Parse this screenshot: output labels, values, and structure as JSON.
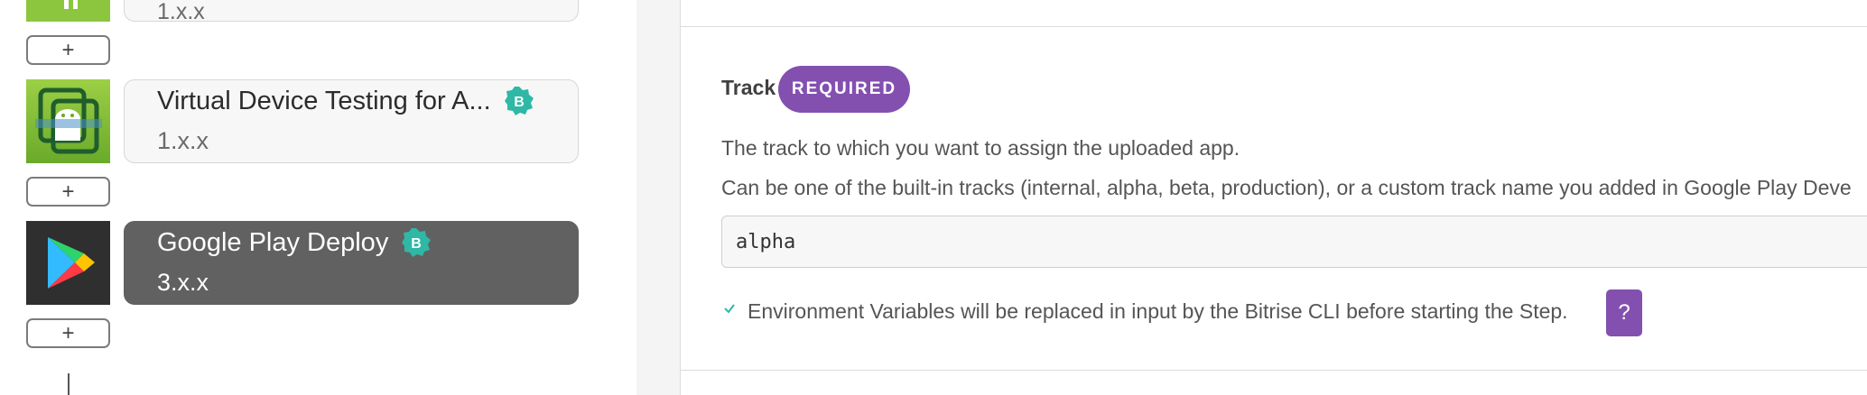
{
  "steps": [
    {
      "title": "",
      "version": "1.x.x",
      "badge": "",
      "selected": false,
      "icon": "android-build-icon"
    },
    {
      "title": "Virtual Device Testing for A...",
      "version": "1.x.x",
      "badge": "B",
      "selected": false,
      "icon": "virtual-device-testing-icon"
    },
    {
      "title": "Google Play Deploy",
      "version": "3.x.x",
      "badge": "B",
      "selected": true,
      "icon": "google-play-icon"
    }
  ],
  "add_step_label": "+",
  "input_field": {
    "label": "Track",
    "required_badge": "REQUIRED",
    "description_1": "The track to which you want to assign the uploaded app.",
    "description_2": "Can be one of the built-in tracks (internal, alpha, beta, production), or a custom track name you added in Google Play Deve",
    "value": "alpha"
  },
  "env_vars_note": "Environment Variables will be replaced in input by the Bitrise CLI before starting the Step.",
  "help_label": "?",
  "colors": {
    "accent_purple": "#8350b0",
    "badge_teal": "#2eb8a5",
    "selected_card": "#616161",
    "android_green": "#8cc63f"
  }
}
